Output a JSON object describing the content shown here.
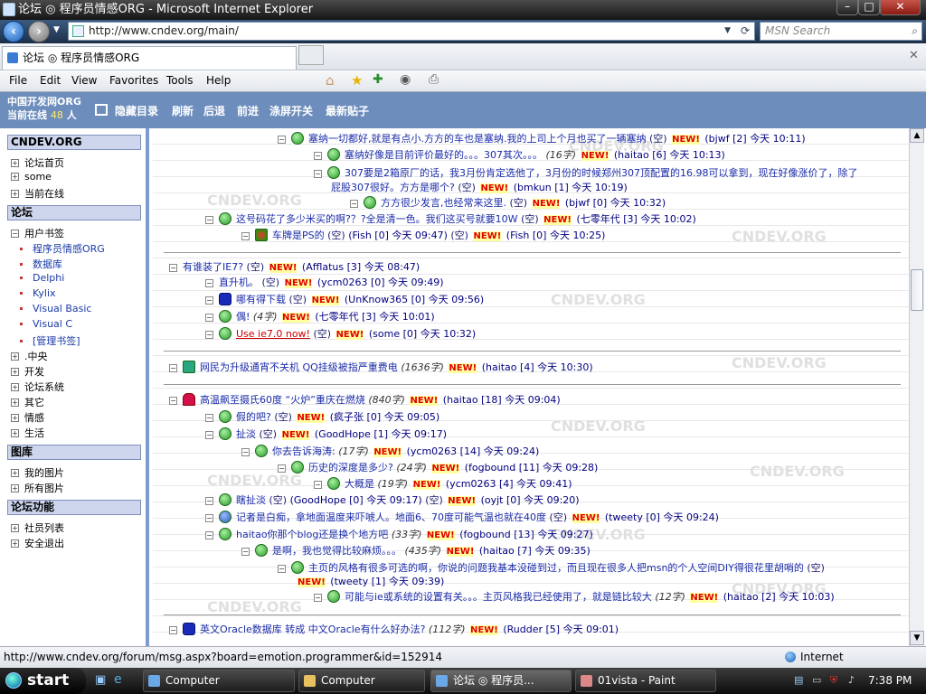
{
  "window": {
    "title": "论坛 ◎ 程序员情感ORG - Microsoft Internet Explorer"
  },
  "address": {
    "url": "http://www.cndev.org/main/",
    "search_placeholder": "MSN Search"
  },
  "tab": {
    "title": "论坛 ◎ 程序员情感ORG"
  },
  "menu": {
    "items": [
      "File",
      "Edit",
      "View",
      "Favorites",
      "Tools",
      "Help"
    ]
  },
  "header": {
    "logo": "中国开发网ORG",
    "online_label": "当前在线",
    "online_count": "48",
    "online_unit": "人",
    "links": [
      "隐藏目录",
      "刷新",
      "后退",
      "前进",
      "涤屏开关",
      "最新贴子"
    ]
  },
  "sidebar": {
    "s1": {
      "title": "CNDEV.ORG",
      "items": [
        "论坛首页",
        "some",
        "当前在线"
      ]
    },
    "s2": {
      "title": "论坛",
      "bookmark": "用户书签",
      "bookmarks": [
        "程序员情感ORG",
        "数据库",
        "Delphi",
        "Kylix",
        "Visual Basic",
        "Visual C",
        "[管理书签]"
      ],
      "items": [
        ".中央",
        "开发",
        "论坛系统",
        "其它",
        "情感",
        "生活"
      ]
    },
    "s3": {
      "title": "图库",
      "items": [
        "我的图片",
        "所有图片"
      ]
    },
    "s4": {
      "title": "论坛功能",
      "items": [
        "社员列表",
        "安全退出"
      ]
    }
  },
  "watermark": "CNDEV.ORG",
  "threads": [
    {
      "title": "塞纳一切都好,就是有点小.方方的车也是塞纳.我的上司上个月也买了一辆塞纳",
      "size": "(空)",
      "user": "(bjwf",
      "count": "[2]",
      "time": "今天 10:11)"
    },
    {
      "title": "塞纳好像是目前评价最好的。。。307其次。。。",
      "size": "(16字)",
      "user": "(haitao",
      "count": "[6]",
      "time": "今天 10:13)"
    },
    {
      "title": "307要是2箱原厂的话，我3月份肯定选他了，3月份的时候郑州307顶配置的16.98可以拿到，现在好像涨价了，除了",
      "title2": "屁股307很好。方方是哪个?",
      "size": "(空)",
      "user": "(bmkun",
      "count": "[1]",
      "time": "今天 10:19)"
    },
    {
      "title": "方方很少发言,也经常来这里.",
      "size": "(空)",
      "user": "(bjwf",
      "count": "[0]",
      "time": "今天 10:32)"
    },
    {
      "title": "这号码花了多少米买的啊?？?全是清一色。我们这买号就要10W",
      "size": "(空)",
      "user": "(七零年代",
      "count": "[3]",
      "time": "今天 10:02)"
    },
    {
      "title": "车牌是PS的",
      "size": "(空)",
      "user": "(Fish",
      "count": "[0]",
      "time": "今天 09:47)",
      "extra": "(空)",
      "user2": "(Fish",
      "count2": "[0]",
      "time2": "今天 10:25)"
    },
    {
      "title": "有谁装了IE7?",
      "size": "(空)",
      "user": "(Afflatus",
      "count": "[3]",
      "time": "今天 08:47)"
    },
    {
      "title": "直升机。",
      "size": "(空)",
      "user": "(ycm0263",
      "count": "[0]",
      "time": "今天 09:49)"
    },
    {
      "title": "哪有得下载",
      "size": "(空)",
      "user": "(UnKnow365",
      "count": "[0]",
      "time": "今天 09:56)"
    },
    {
      "title": "偶!",
      "size": "(4字)",
      "user": "(七零年代",
      "count": "[3]",
      "time": "今天 10:01)"
    },
    {
      "title": "Use ie7.0 now!",
      "size": "(空)",
      "user": "(some",
      "count": "[0]",
      "time": "今天 10:32)"
    },
    {
      "title": "网民为升级通宵不关机 QQ挂级被指严重费电",
      "size": "(1636字)",
      "user": "(haitao",
      "count": "[4]",
      "time": "今天 10:30)"
    },
    {
      "title": "高温飙至摄氏60度 “火炉”重庆在燃烧",
      "size": "(840字)",
      "user": "(haitao",
      "count": "[18]",
      "time": "今天 09:04)"
    },
    {
      "title": "假的吧?",
      "size": "(空)",
      "user": "(疯子张",
      "count": "[0]",
      "time": "今天 09:05)"
    },
    {
      "title": "扯淡",
      "size": "(空)",
      "user": "(GoodHope",
      "count": "[1]",
      "time": "今天 09:17)"
    },
    {
      "title": "你去告诉海涛:",
      "size": "(17字)",
      "user": "(ycm0263",
      "count": "[14]",
      "time": "今天 09:24)"
    },
    {
      "title": "历史的深度是多少?",
      "size": "(24字)",
      "user": "(fogbound",
      "count": "[11]",
      "time": "今天 09:28)"
    },
    {
      "title": "大概是",
      "size": "(19字)",
      "user": "(ycm0263",
      "count": "[4]",
      "time": "今天 09:41)"
    },
    {
      "title": "瞎扯淡",
      "size": "(空)",
      "user": "(GoodHope",
      "count": "[0]",
      "time": "今天 09:17)",
      "extra": "(空)",
      "user2": "(oyjt",
      "count2": "[0]",
      "time2": "今天 09:20)"
    },
    {
      "title": "记者是白痴，拿地面温度来吓唬人。地面6、70度可能气温也就在40度",
      "size": "(空)",
      "user": "(tweety",
      "count": "[0]",
      "time": "今天 09:24)"
    },
    {
      "title": "haitao你那个blog还是换个地方吧",
      "size": "(33字)",
      "user": "(fogbound",
      "count": "[13]",
      "time": "今天 09:27)"
    },
    {
      "title": "是啊，我也觉得比较麻烦。。。",
      "size": "(435字)",
      "user": "(haitao",
      "count": "[7]",
      "time": "今天 09:35)"
    },
    {
      "title": "主页的风格有很多可选的啊，你说的问题我基本没碰到过，而且现在很多人把msn的个人空间DIY得很花里胡哨的",
      "size": "(空)",
      "user": "(tweety",
      "count": "[1]",
      "time": "今天 09:39)"
    },
    {
      "title": "可能与ie或系统的设置有关。。。主页风格我已经使用了，就是链比较大",
      "size": "(12字)",
      "user": "(haitao",
      "count": "[2]",
      "time": "今天 10:03)"
    },
    {
      "title": "英文Oracle数据库 转成 中文Oracle有什么好办法?",
      "size": "(112字)",
      "user": "(Rudder",
      "count": "[5]",
      "time": "今天 09:01)"
    }
  ],
  "new_label": "NEW!",
  "status": {
    "url": "http://www.cndev.org/forum/msg.aspx?board=emotion.programmer&id=152914",
    "zone": "Internet"
  },
  "taskbar": {
    "start": "start",
    "items": [
      "Computer",
      "Computer",
      "论坛 ◎ 程序员...",
      "01vista - Paint"
    ],
    "time": "7:38 PM"
  }
}
